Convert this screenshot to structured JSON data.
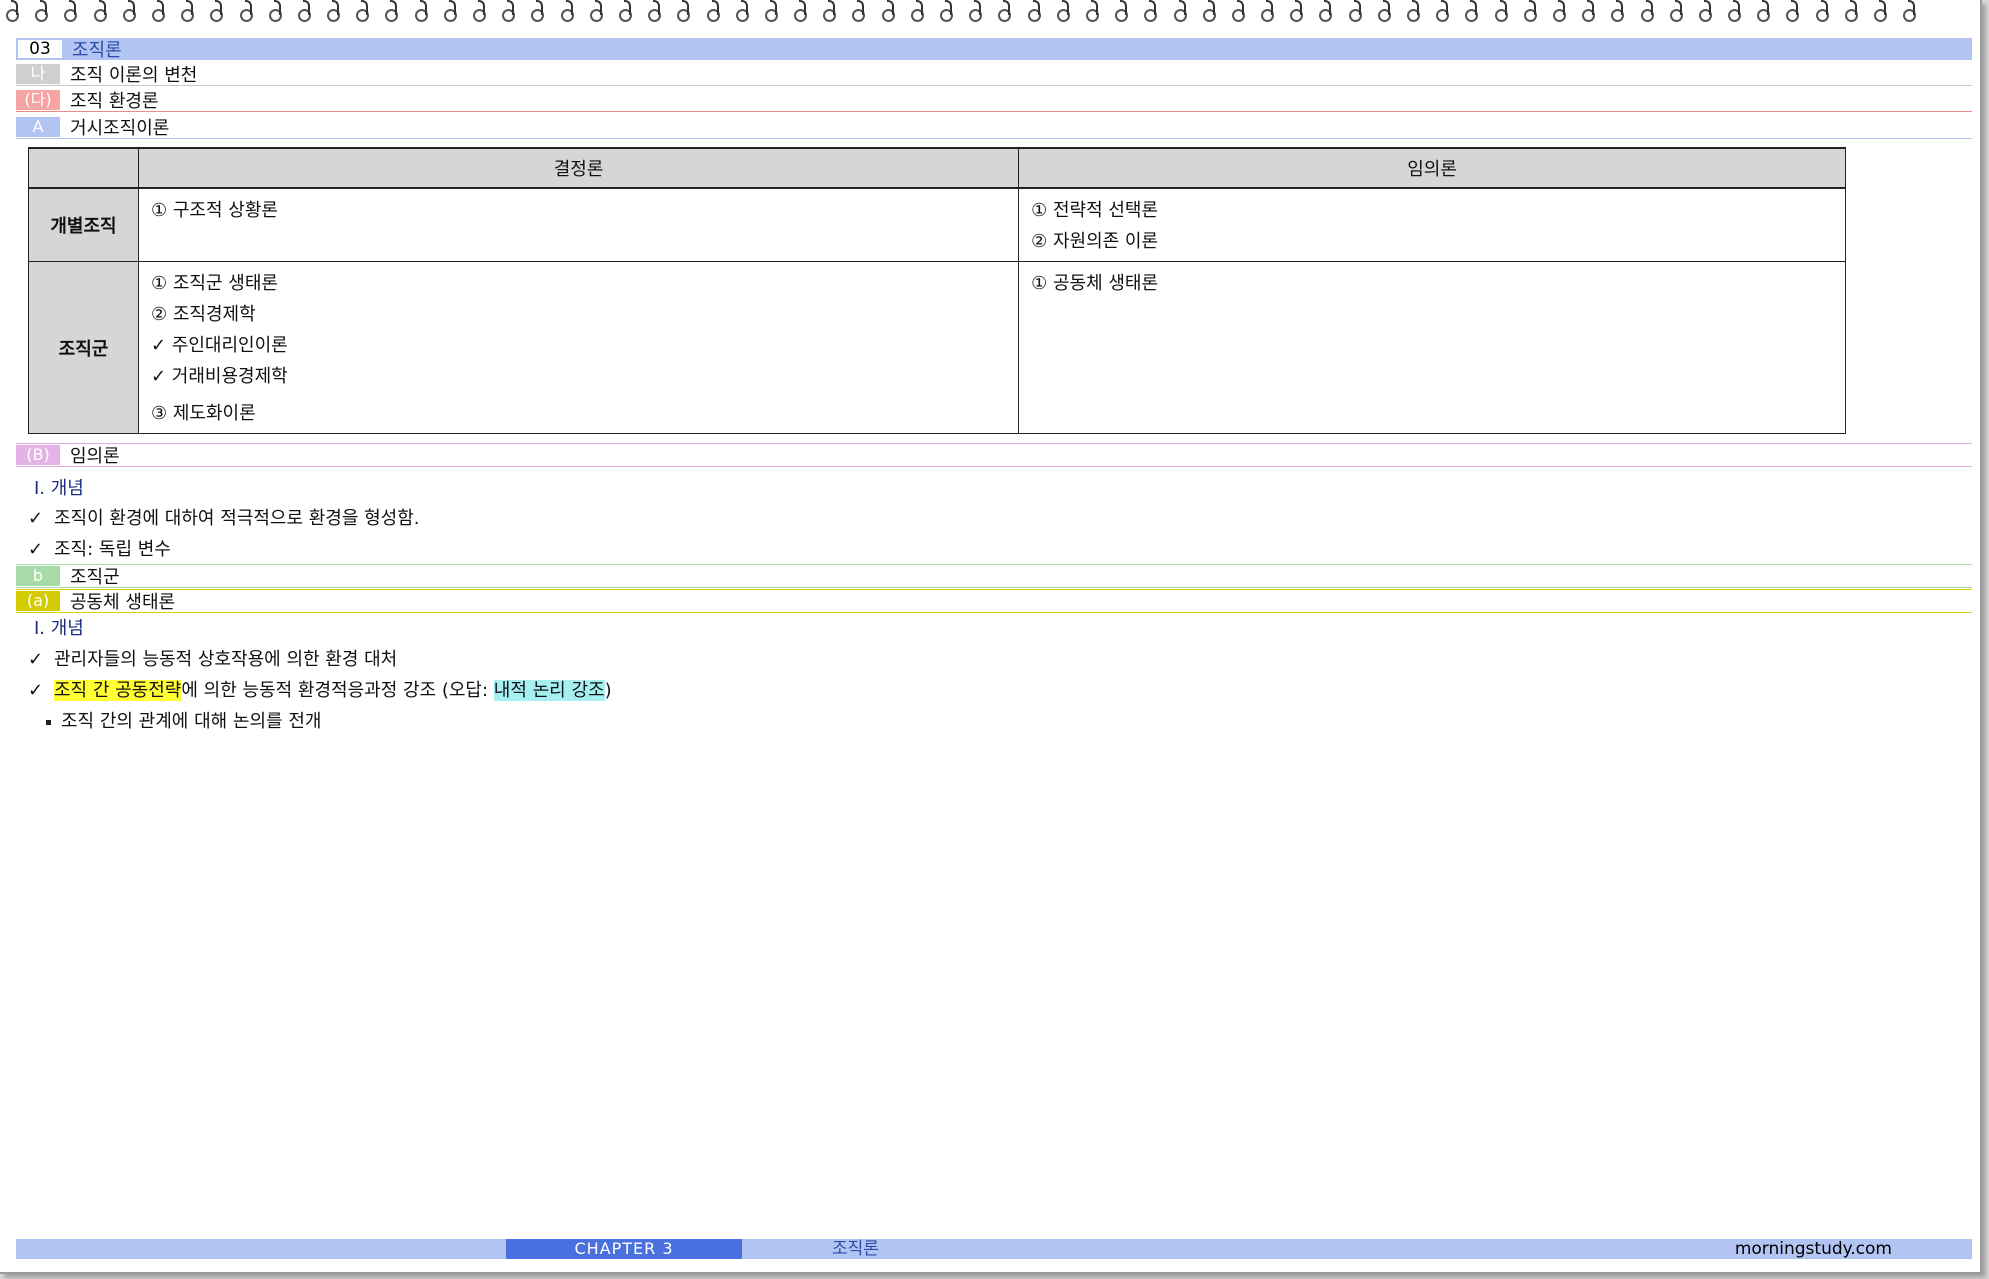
{
  "section": {
    "number": "03",
    "title": "조직론"
  },
  "sub": {
    "tag": "나",
    "title": "조직 이론의 변천"
  },
  "subsub": {
    "tag": "(다)",
    "title": "조직 환경론"
  },
  "part_a": {
    "tag": "A",
    "title": "거시조직이론"
  },
  "table": {
    "headers": [
      "결정론",
      "임의론"
    ],
    "rows": [
      {
        "label": "개별조직",
        "det": [
          "① 구조적 상황론"
        ],
        "vol": [
          "① 전략적 선택론",
          "② 자원의존 이론"
        ]
      },
      {
        "label": "조직군",
        "det": [
          "① 조직군 생태론",
          "② 조직경제학",
          "✓ 주인대리인이론",
          "✓ 거래비용경제학",
          "③ 제도화이론"
        ],
        "vol": [
          "① 공동체 생태론"
        ]
      }
    ]
  },
  "part_b": {
    "tag": "(B)",
    "title": "임의론"
  },
  "voluntarism": {
    "concept": "Ⅰ. 개념",
    "checks": [
      "조직이 환경에 대하여 적극적으로 환경을 형성함.",
      "조직: 독립 변수"
    ]
  },
  "part_small_b": {
    "tag": "b",
    "title": "조직군"
  },
  "part_small_a": {
    "tag": "(a)",
    "title": "공동체 생태론"
  },
  "community": {
    "concept": "Ⅰ. 개념",
    "check1": "관리자들의 능동적 상호작용에 의한 환경 대처",
    "check2_hl": "조직 간 공동전략",
    "check2_mid": "에 의한 능동적 환경적응과정 강조 (오답: ",
    "check2_hl2": "내적 논리 강조",
    "check2_end": ")",
    "bullet": "조직 간의 관계에 대해 논의를 전개"
  },
  "check_mark": "✓",
  "footer": {
    "chapter": "CHAPTER 3",
    "title": "조직론",
    "site": "morningstudy.com"
  }
}
